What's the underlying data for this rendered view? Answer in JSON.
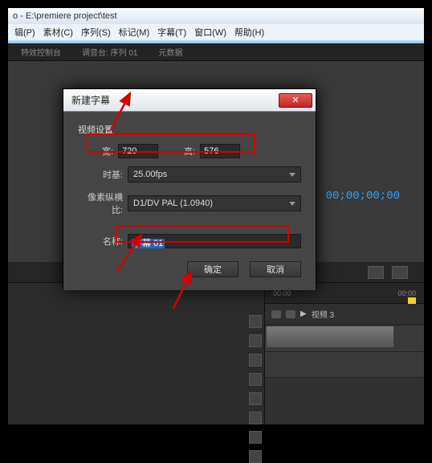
{
  "title": "o - E:\\premiere project\\test",
  "menu": {
    "edit": "辑(P)",
    "clip": "素材(C)",
    "seq": "序列(S)",
    "marker": "标记(M)",
    "title": "字幕(T)",
    "window": "窗口(W)",
    "help": "帮助(H)"
  },
  "tabs": {
    "effects": "特效控制台",
    "mixer": "调音台: 序列 01",
    "metadata": "元数据"
  },
  "timecode": "00;00;00;00",
  "timeline": {
    "ruler_start": "00:00",
    "ruler_mid": "00:00",
    "track_label": "视频 3",
    "expand": "▶"
  },
  "dialog": {
    "title": "新建字幕",
    "close": "✕",
    "section": "视频设置",
    "width_label": "宽:",
    "width_value": "720",
    "height_label": "高:",
    "height_value": "576",
    "timebase_label": "时基:",
    "timebase_value": "25.00fps",
    "par_label": "像素纵横比:",
    "par_value": "D1/DV PAL (1.0940)",
    "name_label": "名称:",
    "name_value": "字幕 01",
    "ok": "确定",
    "cancel": "取消"
  },
  "colors": {
    "highlight_red": "#d40000",
    "accent_blue": "#2aa6ff"
  }
}
